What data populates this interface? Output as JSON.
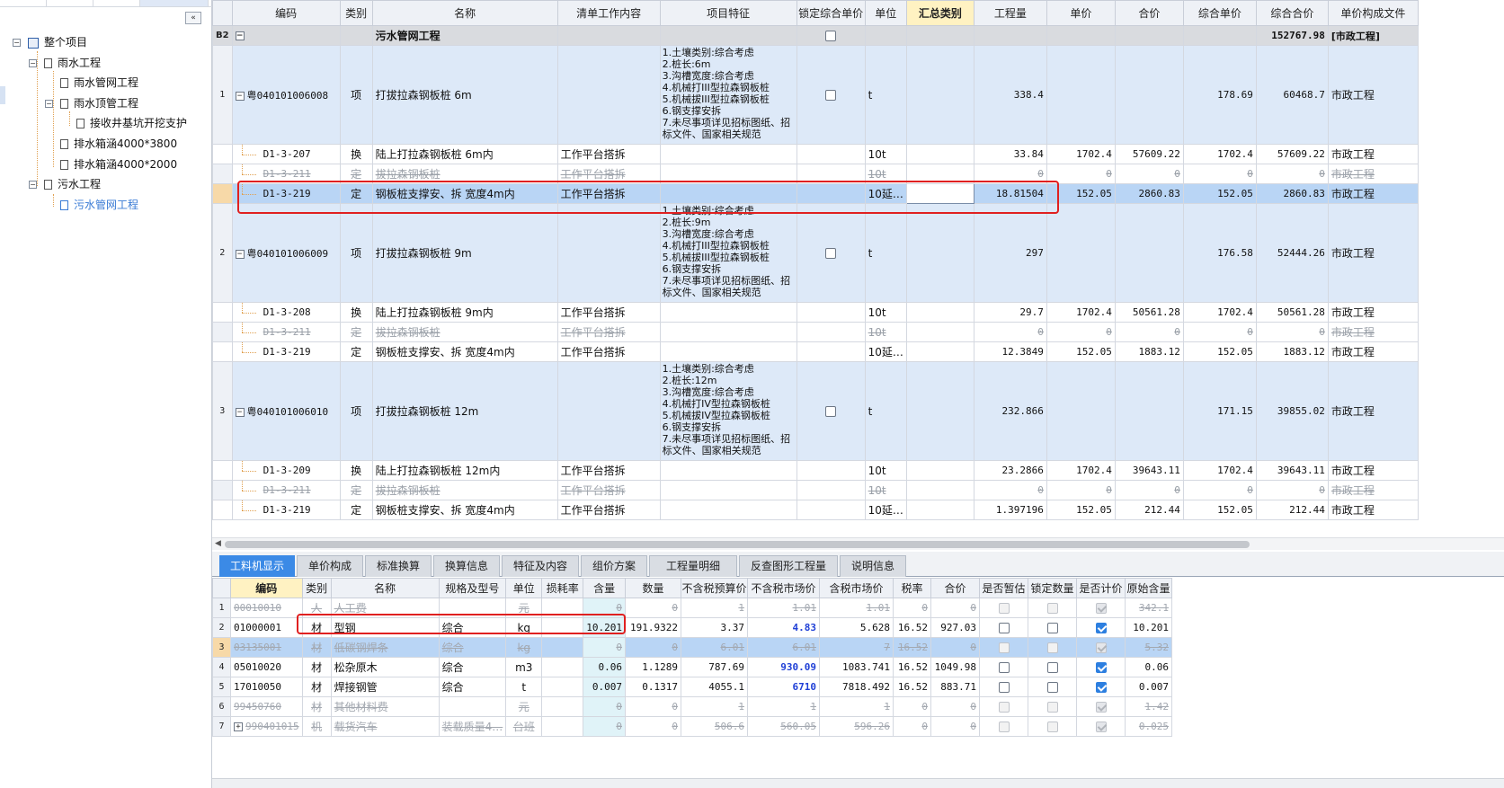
{
  "tree": {
    "nodes": [
      {
        "label": "整个项目",
        "level": 0,
        "toggle": "−",
        "kind": "root"
      },
      {
        "label": "雨水工程",
        "level": 1,
        "toggle": "−",
        "kind": "folder"
      },
      {
        "label": "雨水管网工程",
        "level": 2,
        "toggle": "",
        "kind": "file"
      },
      {
        "label": "雨水顶管工程",
        "level": 2,
        "toggle": "−",
        "kind": "file"
      },
      {
        "label": "接收井基坑开挖支护",
        "level": 3,
        "toggle": "",
        "kind": "file"
      },
      {
        "label": "排水箱涵4000*3800",
        "level": 2,
        "toggle": "",
        "kind": "file"
      },
      {
        "label": "排水箱涵4000*2000",
        "level": 2,
        "toggle": "",
        "kind": "file"
      },
      {
        "label": "污水工程",
        "level": 1,
        "toggle": "−",
        "kind": "folder"
      },
      {
        "label": "污水管网工程",
        "level": 2,
        "toggle": "",
        "kind": "file",
        "active": true
      }
    ],
    "collapse_label": "«"
  },
  "top_grid": {
    "headers": [
      "",
      "编码",
      "类别",
      "名称",
      "清单工作内容",
      "项目特征",
      "锁定综合单价",
      "单位",
      "汇总类别",
      "工程量",
      "单价",
      "合价",
      "综合单价",
      "综合合价",
      "单价构成文件"
    ],
    "group_row": {
      "rn": "B2",
      "toggle": "−",
      "name": "污水管网工程",
      "total": "152767.98",
      "file": "[市政工程]"
    },
    "features": {
      "f6": "1.土壤类别:综合考虑\n2.桩长:6m\n3.沟槽宽度:综合考虑\n4.机械打III型拉森钢板桩\n5.机械拔III型拉森钢板桩\n6.钢支撑安拆\n7.未尽事项详见招标图纸、招标文件、国家相关规范",
      "f9": "1.土壤类别:综合考虑\n2.桩长:9m\n3.沟槽宽度:综合考虑\n4.机械打III型拉森钢板桩\n5.机械拔III型拉森钢板桩\n6.钢支撑安拆\n7.未尽事项详见招标图纸、招标文件、国家相关规范",
      "f12": "1.土壤类别:综合考虑\n2.桩长:12m\n3.沟槽宽度:综合考虑\n4.机械打IV型拉森钢板桩\n5.机械拔IV型拉森钢板桩\n6.钢支撑安拆\n7.未尽事项详见招标图纸、招标文件、国家相关规范"
    },
    "rows": [
      {
        "type": "item",
        "rn": "1",
        "code": "粤040101006008",
        "cat": "项",
        "name": "打拔拉森钢板桩 6m",
        "work": "",
        "feat": "f6",
        "unit": "t",
        "sum": "",
        "qty": "338.4",
        "price": "",
        "amount": "",
        "cprice": "178.69",
        "camount": "60468.7",
        "file": "市政工程"
      },
      {
        "type": "sub",
        "rn": "",
        "code": "D1-3-207",
        "cat": "换",
        "name": "陆上打拉森钢板桩 6m内",
        "work": "工作平台搭拆",
        "unit": "10t",
        "sum": "",
        "qty": "33.84",
        "price": "1702.4",
        "amount": "57609.22",
        "cprice": "1702.4",
        "camount": "57609.22",
        "file": "市政工程"
      },
      {
        "type": "strike",
        "rn": "",
        "code": "D1-3-211",
        "cat": "定",
        "name": "拔拉森钢板桩",
        "work": "工作平台搭拆",
        "unit": "10t",
        "sum": "",
        "qty": "0",
        "price": "0",
        "amount": "0",
        "cprice": "0",
        "camount": "0",
        "file": "市政工程"
      },
      {
        "type": "selrow",
        "rn": "",
        "code": "D1-3-219",
        "cat": "定",
        "name": "钢板桩支撑安、拆 宽度4m内",
        "work": "工作平台搭拆",
        "unit": "10延…",
        "sum": "",
        "qty": "18.81504",
        "price": "152.05",
        "amount": "2860.83",
        "cprice": "152.05",
        "camount": "2860.83",
        "file": "市政工程"
      },
      {
        "type": "item",
        "rn": "2",
        "code": "粤040101006009",
        "cat": "项",
        "name": "打拔拉森钢板桩 9m",
        "work": "",
        "feat": "f9",
        "unit": "t",
        "sum": "",
        "qty": "297",
        "price": "",
        "amount": "",
        "cprice": "176.58",
        "camount": "52444.26",
        "file": "市政工程"
      },
      {
        "type": "sub",
        "rn": "",
        "code": "D1-3-208",
        "cat": "换",
        "name": "陆上打拉森钢板桩 9m内",
        "work": "工作平台搭拆",
        "unit": "10t",
        "sum": "",
        "qty": "29.7",
        "price": "1702.4",
        "amount": "50561.28",
        "cprice": "1702.4",
        "camount": "50561.28",
        "file": "市政工程"
      },
      {
        "type": "strike",
        "rn": "",
        "code": "D1-3-211",
        "cat": "定",
        "name": "拔拉森钢板桩",
        "work": "工作平台搭拆",
        "unit": "10t",
        "sum": "",
        "qty": "0",
        "price": "0",
        "amount": "0",
        "cprice": "0",
        "camount": "0",
        "file": "市政工程"
      },
      {
        "type": "sub",
        "rn": "",
        "code": "D1-3-219",
        "cat": "定",
        "name": "钢板桩支撑安、拆 宽度4m内",
        "work": "工作平台搭拆",
        "unit": "10延…",
        "sum": "",
        "qty": "12.3849",
        "price": "152.05",
        "amount": "1883.12",
        "cprice": "152.05",
        "camount": "1883.12",
        "file": "市政工程"
      },
      {
        "type": "item",
        "rn": "3",
        "code": "粤040101006010",
        "cat": "项",
        "name": "打拔拉森钢板桩 12m",
        "work": "",
        "feat": "f12",
        "unit": "t",
        "sum": "",
        "qty": "232.866",
        "price": "",
        "amount": "",
        "cprice": "171.15",
        "camount": "39855.02",
        "file": "市政工程"
      },
      {
        "type": "sub",
        "rn": "",
        "code": "D1-3-209",
        "cat": "换",
        "name": "陆上打拉森钢板桩 12m内",
        "work": "工作平台搭拆",
        "unit": "10t",
        "sum": "",
        "qty": "23.2866",
        "price": "1702.4",
        "amount": "39643.11",
        "cprice": "1702.4",
        "camount": "39643.11",
        "file": "市政工程"
      },
      {
        "type": "strike",
        "rn": "",
        "code": "D1-3-211",
        "cat": "定",
        "name": "拔拉森钢板桩",
        "work": "工作平台搭拆",
        "unit": "10t",
        "sum": "",
        "qty": "0",
        "price": "0",
        "amount": "0",
        "cprice": "0",
        "camount": "0",
        "file": "市政工程"
      },
      {
        "type": "sub",
        "rn": "",
        "code": "D1-3-219",
        "cat": "定",
        "name": "钢板桩支撑安、拆 宽度4m内",
        "work": "工作平台搭拆",
        "unit": "10延…",
        "sum": "",
        "qty": "1.397196",
        "price": "152.05",
        "amount": "212.44",
        "cprice": "152.05",
        "camount": "212.44",
        "file": "市政工程"
      }
    ]
  },
  "tabs": [
    "工料机显示",
    "单价构成",
    "标准换算",
    "换算信息",
    "特征及内容",
    "组价方案",
    "工程量明细",
    "反查图形工程量",
    "说明信息"
  ],
  "bottom_grid": {
    "headers": [
      "",
      "编码",
      "类别",
      "名称",
      "规格及型号",
      "单位",
      "损耗率",
      "含量",
      "数量",
      "不含税预算价",
      "不含税市场价",
      "含税市场价",
      "税率",
      "合价",
      "是否暂估",
      "锁定数量",
      "是否计价",
      "原始含量"
    ],
    "rows": [
      {
        "rn": "1",
        "style": "gone",
        "toggle": "",
        "code": "00010010",
        "cat": "人",
        "name": "人工费",
        "spec": "",
        "unit": "元",
        "loss": "",
        "content": "0",
        "qty": "0",
        "pre": "1",
        "mkt": "1.01",
        "mkt_tax": "1.01",
        "tax": "0",
        "amount": "0",
        "est": "dis",
        "lock": "dis",
        "priced": "dis-on",
        "orig": "342.1"
      },
      {
        "rn": "2",
        "style": "normal",
        "toggle": "",
        "code": "01000001",
        "cat": "材",
        "name": "型钢",
        "spec": "综合",
        "unit": "kg",
        "loss": "",
        "content": "10.201",
        "qty": "191.9322",
        "pre": "3.37",
        "mkt": "4.83",
        "mkt_bold": true,
        "mkt_tax": "5.628",
        "tax": "16.52",
        "amount": "927.03",
        "est": "off",
        "lock": "off",
        "priced": "on",
        "orig": "10.201"
      },
      {
        "rn": "3",
        "style": "gone-sel",
        "toggle": "",
        "code": "03135001",
        "cat": "材",
        "name": "低碳钢焊条",
        "spec": "综合",
        "unit": "kg",
        "loss": "",
        "content": "0",
        "qty": "0",
        "pre": "6.01",
        "mkt": "6.01",
        "mkt_tax": "7",
        "tax": "16.52",
        "amount": "0",
        "est": "dis",
        "lock": "dis",
        "priced": "dis-on",
        "orig": "5.32"
      },
      {
        "rn": "4",
        "style": "normal",
        "toggle": "",
        "code": "05010020",
        "cat": "材",
        "name": "松杂原木",
        "spec": "综合",
        "unit": "m3",
        "loss": "",
        "content": "0.06",
        "qty": "1.1289",
        "pre": "787.69",
        "mkt": "930.09",
        "mkt_bold": true,
        "mkt_tax": "1083.741",
        "tax": "16.52",
        "amount": "1049.98",
        "est": "off",
        "lock": "off",
        "priced": "on",
        "orig": "0.06"
      },
      {
        "rn": "5",
        "style": "normal",
        "toggle": "",
        "code": "17010050",
        "cat": "材",
        "name": "焊接钢管",
        "spec": "综合",
        "unit": "t",
        "loss": "",
        "content": "0.007",
        "qty": "0.1317",
        "pre": "4055.1",
        "mkt": "6710",
        "mkt_bold": true,
        "mkt_tax": "7818.492",
        "tax": "16.52",
        "amount": "883.71",
        "est": "off",
        "lock": "off",
        "priced": "on",
        "orig": "0.007"
      },
      {
        "rn": "6",
        "style": "gone",
        "toggle": "",
        "code": "99450760",
        "cat": "材",
        "name": "其他材料费",
        "spec": "",
        "unit": "元",
        "loss": "",
        "content": "0",
        "qty": "0",
        "pre": "1",
        "mkt": "1",
        "mkt_tax": "1",
        "tax": "0",
        "amount": "0",
        "est": "dis",
        "lock": "dis",
        "priced": "dis-on",
        "orig": "1.42"
      },
      {
        "rn": "7",
        "style": "gone",
        "toggle": "+",
        "code": "990401015",
        "cat": "机",
        "name": "载货汽车",
        "spec": "装载质量4…",
        "unit": "台班",
        "loss": "",
        "content": "0",
        "qty": "0",
        "pre": "506.6",
        "mkt": "560.05",
        "mkt_tax": "596.26",
        "tax": "0",
        "amount": "0",
        "est": "dis",
        "lock": "dis",
        "priced": "dis-on",
        "orig": "0.025"
      }
    ]
  }
}
